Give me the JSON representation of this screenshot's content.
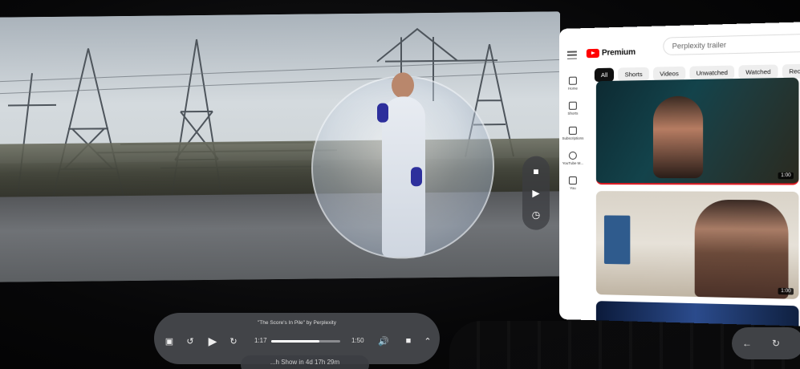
{
  "player": {
    "video_title": "\"The Score's In Pile\" by Perplexity",
    "current_time": "1:17",
    "duration": "1:50",
    "progress": 0.7
  },
  "toast": {
    "text": "...h Show in 4d 17h 29m"
  },
  "youtube": {
    "logo_text": "Premium",
    "search_value": "Perplexity trailer",
    "chips": [
      "All",
      "Shorts",
      "Videos",
      "Unwatched",
      "Watched",
      "Recently"
    ],
    "active_chip": "All",
    "nav": [
      {
        "label": "Home",
        "icon": "home-icon"
      },
      {
        "label": "Shorts",
        "icon": "shorts-icon"
      },
      {
        "label": "Subscriptions",
        "icon": "subscriptions-icon"
      },
      {
        "label": "YouTube M...",
        "icon": "youtube-music-icon"
      },
      {
        "label": "You",
        "icon": "library-icon"
      }
    ],
    "thumbnails": [
      {
        "duration": "1:00"
      },
      {
        "duration": "1:00"
      }
    ]
  },
  "colors": {
    "youtube_red": "#ff0000",
    "panel_bg": "#ffffff",
    "control_bg": "#484a4e"
  }
}
